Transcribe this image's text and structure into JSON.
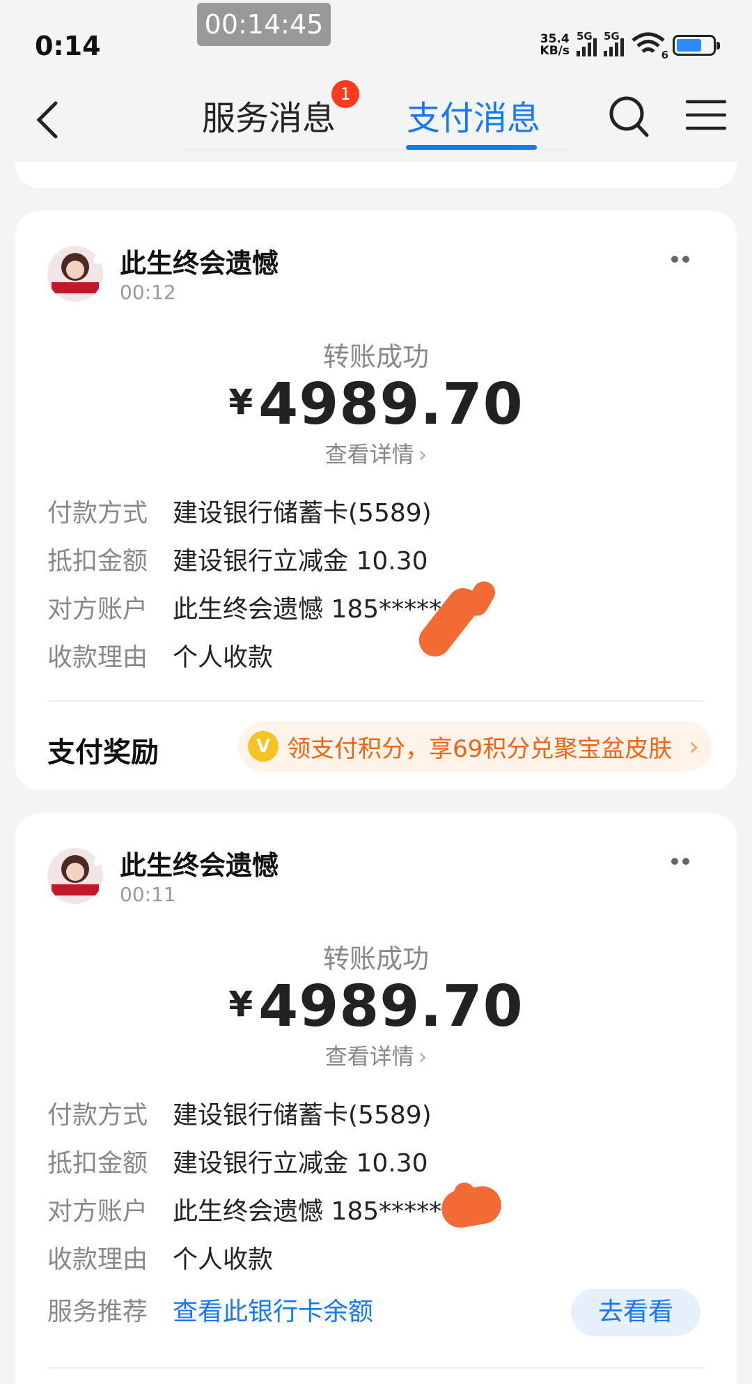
{
  "status_bar": {
    "time": "0:14",
    "timer": "00:14:45",
    "net_speed_value": "35.4",
    "net_speed_unit": "KB/s",
    "sim1": "5G",
    "sim2": "5G",
    "wifi_index": "6",
    "battery_level": 0.7
  },
  "nav": {
    "tabs": [
      {
        "label": "服务消息",
        "badge": "1",
        "active": false
      },
      {
        "label": "支付消息",
        "active": true
      }
    ],
    "accent_color": "#1677ff"
  },
  "labels": {
    "payment_method": "付款方式",
    "deduction": "抵扣金额",
    "counterparty": "对方账户",
    "reason": "收款理由",
    "service": "服务推荐"
  },
  "cards": [
    {
      "sender": "此生终会遗憾",
      "time": "00:12",
      "status": "转账成功",
      "currency": "¥",
      "amount": "4989.70",
      "details_link": "查看详情",
      "payment_method": "建设银行储蓄卡(5589)",
      "deduction": "建设银行立减金 10.30",
      "counterparty": "此生终会遗憾 185*****",
      "reason": "个人收款",
      "reward_label": "支付奖励",
      "reward_coin": "V",
      "reward_text": "领支付积分，享69积分兑聚宝盆皮肤"
    },
    {
      "sender": "此生终会遗憾",
      "time": "00:11",
      "status": "转账成功",
      "currency": "¥",
      "amount": "4989.70",
      "details_link": "查看详情",
      "payment_method": "建设银行储蓄卡(5589)",
      "deduction": "建设银行立减金 10.30",
      "counterparty": "此生终会遗憾 185******",
      "reason": "个人收款",
      "service": "查看此银行卡余额",
      "go_button": "去看看"
    }
  ]
}
